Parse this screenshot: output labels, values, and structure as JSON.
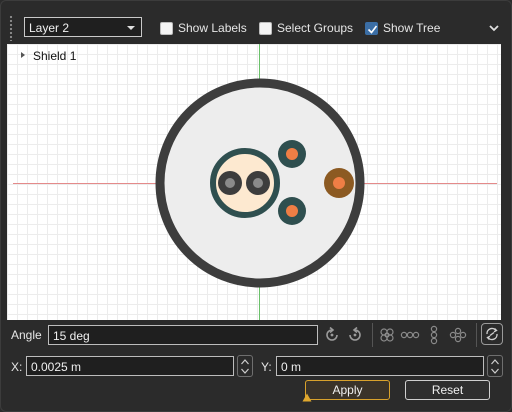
{
  "toolbar": {
    "layer_selected": "Layer 2",
    "checkboxes": [
      {
        "label": "Show Labels",
        "checked": false
      },
      {
        "label": "Select Groups",
        "checked": false
      },
      {
        "label": "Show Tree",
        "checked": true
      }
    ]
  },
  "tree": {
    "root_label": "Shield 1"
  },
  "controls": {
    "angle_label": "Angle",
    "angle_value": "15 deg",
    "x_label": "X:",
    "x_value": "0.0025 m",
    "y_label": "Y:",
    "y_value": "0 m",
    "apply_label": "Apply",
    "reset_label": "Reset"
  },
  "colors": {
    "accent_blue": "#3b6ea5",
    "apply_border": "#d9a22c",
    "jacket": "#3d3d3d",
    "shield_fill": "#ededed",
    "core_ring": "#2f4f4f",
    "core_fill": "#fde9d0",
    "conductor": "#ef7e45",
    "drain": "#8c5a22"
  },
  "icons": [
    "grip-icon",
    "dropdown-caret-icon",
    "collapse-chevron-icon",
    "tree-expand-icon",
    "rotate-ccw-icon",
    "rotate-cw-icon",
    "bundle-icon",
    "chain-horizontal-icon",
    "chain-vertical-icon",
    "scatter-icon",
    "refresh-link-icon",
    "spin-up-icon",
    "spin-down-icon",
    "warning-icon"
  ]
}
